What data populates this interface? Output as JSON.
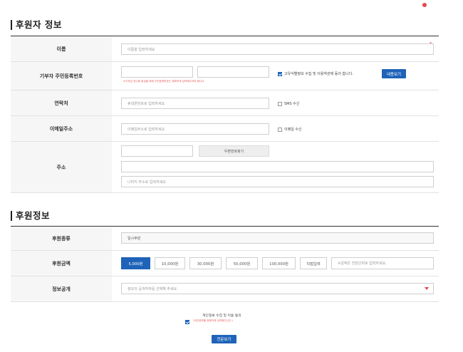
{
  "donor_section": {
    "title": "후원자 정보",
    "name": {
      "label": "이름",
      "placeholder": "이름을 입력하세요",
      "required_mark": "*"
    },
    "resident_id": {
      "label": "기부자 주민등록번호",
      "note": "※기부금 영수증 발급을 위해 주민등록번호는 정확하게 입력해주셔야 합니다.",
      "consent_label": "고유식별정보 수집 및 이용약관에 동의 합니다.",
      "view_button": "내용보기"
    },
    "phone": {
      "label": "연락처",
      "placeholder": "휴대폰번호로 입력하세요",
      "sms_label": "SMS 수신"
    },
    "email": {
      "label": "이메일주소",
      "placeholder": "이메일주소로 입력하세요",
      "email_label": "이메일 수신"
    },
    "address": {
      "label": "주소",
      "zip_button": "우편번호찾기",
      "detail_placeholder": "나머지 주소로 입력하세요"
    }
  },
  "donation_section": {
    "title": "후원정보",
    "type": {
      "label": "후원종류",
      "value": "일시후원"
    },
    "amount": {
      "label": "후원금액",
      "options": [
        "5,000원",
        "10,000원",
        "30,000원",
        "50,000원",
        "100,000원",
        "직접입력"
      ],
      "selected_index": 0,
      "custom_placeholder": "※금액은 천원단위로 입력하세요."
    },
    "disclosure": {
      "label": "정보공개",
      "placeholder": "정보의 공개여부를 선택해 주세요."
    }
  },
  "agreement": {
    "label": "개인정보 수집 및 이용 동의",
    "sub": "(개인정보를 정확하게 입력해주신다.)",
    "button": "전문보기"
  },
  "colors": {
    "accent": "#1f63b9",
    "alert": "#e8474e",
    "label_bg": "#f6f6f6"
  }
}
